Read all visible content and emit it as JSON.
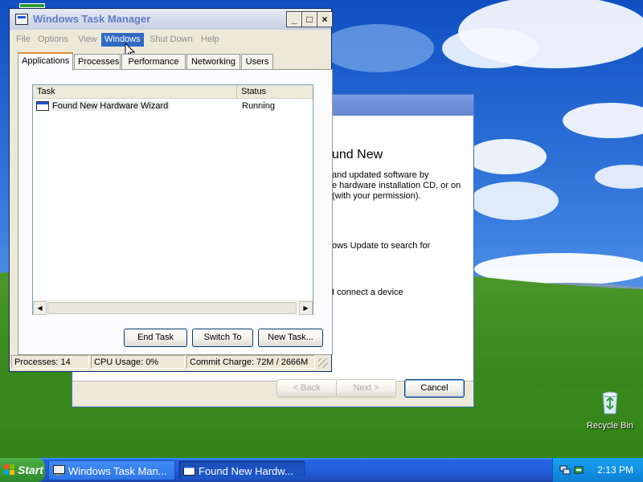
{
  "desktop": {
    "recycle_bin_label": "Recycle Bin"
  },
  "wizard": {
    "title": "",
    "heading": "und New",
    "para1": [
      "and updated software by",
      "e hardware installation CD, or on",
      "(with your permission)."
    ],
    "para2": "ows Update to search for",
    "para3": "I connect a device",
    "buttons": {
      "back": "< Back",
      "next": "Next >",
      "cancel": "Cancel"
    }
  },
  "task_manager": {
    "title": "Windows Task Manager",
    "menu": [
      "File",
      "Options",
      "View",
      "Windows",
      "Shut Down",
      "Help"
    ],
    "active_menu": "Windows",
    "tabs": [
      "Applications",
      "Processes",
      "Performance",
      "Networking",
      "Users"
    ],
    "selected_tab": "Applications",
    "columns": {
      "task": "Task",
      "status": "Status"
    },
    "rows": [
      {
        "task": "Found New Hardware Wizard",
        "status": "Running"
      }
    ],
    "buttons": {
      "end_task": "End Task",
      "switch_to": "Switch To",
      "new_task": "New Task..."
    },
    "status": {
      "processes": "Processes: 14",
      "cpu": "CPU Usage: 0%",
      "commit": "Commit Charge: 72M / 2666M"
    },
    "window_buttons": {
      "minimize": "_",
      "maximize": "□",
      "close": "×"
    }
  },
  "taskbar": {
    "start_label": "Start",
    "buttons": [
      {
        "label": "Windows Task Man..."
      },
      {
        "label": "Found New Hardw..."
      }
    ],
    "clock": "2:13 PM"
  },
  "colors": {
    "title_active": "#0a4cc8",
    "menu_highlight": "#316ac5",
    "tab_accent": "#e68b2c",
    "taskbar": "#245edb",
    "tray": "#1290e4",
    "start": "#3a9c36"
  }
}
